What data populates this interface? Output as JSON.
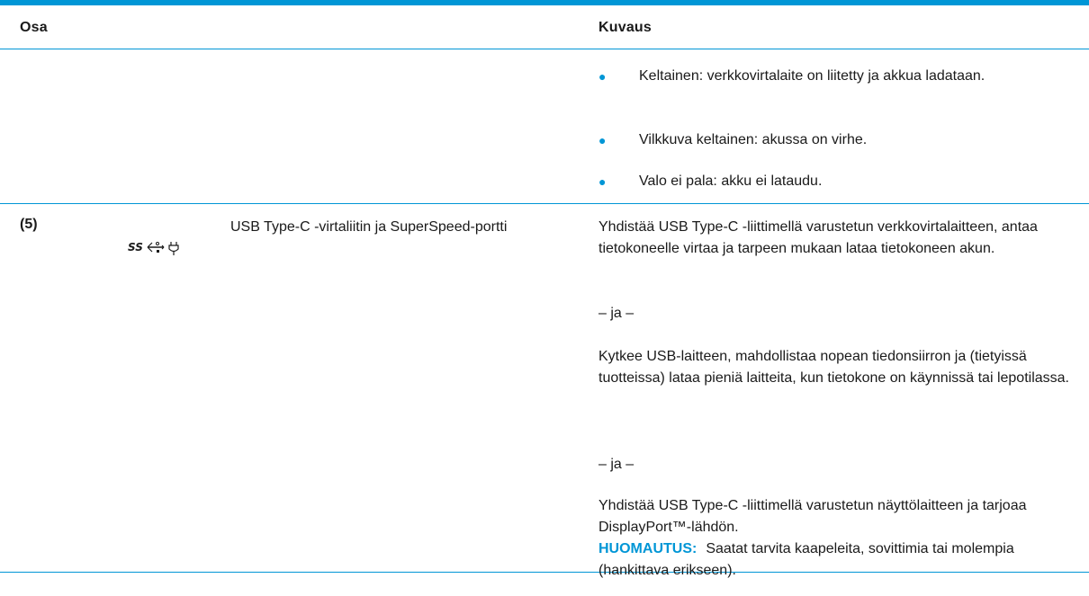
{
  "table": {
    "header": {
      "col_osa": "Osa",
      "col_kuvaus": "Kuvaus"
    },
    "row_continued": {
      "bullets": [
        "Keltainen: verkkovirtalaite on liitetty ja akkua ladataan.",
        "Vilkkuva keltainen: akussa on virhe.",
        "Valo ei pala: akku ei lataudu."
      ]
    },
    "row_5": {
      "number": "(5)",
      "icon": "usb-superspeed-power-icon",
      "icon_glyph": "SS⇠⭢ ⏻",
      "component": "USB Type-C -virtaliitin ja SuperSpeed-portti",
      "paragraphs": [
        "Yhdistää USB Type-C -liittimellä varustetun verkkovirtalaitteen, antaa tietokoneelle virtaa ja tarpeen mukaan lataa tietokoneen akun.",
        "– ja –",
        "Kytkee USB-laitteen, mahdollistaa nopean tiedonsiirron ja (tietyissä tuotteissa) lataa pieniä laitteita, kun tietokone on käynnissä tai lepotilassa.",
        "– ja –",
        "Yhdistää USB Type-C -liittimellä varustetun näyttölaitteen ja tarjoaa DisplayPort™-lähdön."
      ],
      "note_label": "HUOMAUTUS:",
      "note_text": "Saatat tarvita kaapeleita, sovittimia tai molempia (hankittava erikseen)."
    }
  },
  "colors": {
    "accent": "#0096d6",
    "text": "#1a1a1a"
  }
}
